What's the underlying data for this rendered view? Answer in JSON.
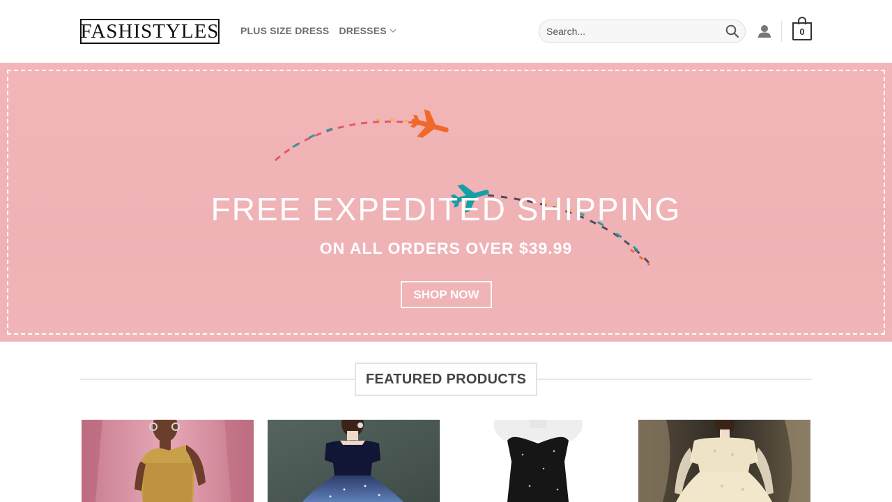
{
  "header": {
    "logo_text": "FASHISTYLES",
    "nav": [
      {
        "label": "PLUS SIZE DRESS",
        "has_dropdown": false
      },
      {
        "label": "DRESSES",
        "has_dropdown": true
      }
    ],
    "search_placeholder": "Search...",
    "cart_count": "0",
    "icons": {
      "search": "search-icon",
      "account": "user-icon",
      "cart": "shopping-bag-icon",
      "dropdown": "chevron-down-icon"
    }
  },
  "banner": {
    "title": "FREE EXPEDITED SHIPPING",
    "subtitle": "ON ALL ORDERS OVER $39.99",
    "button_label": "SHOP NOW",
    "background_color": "#f0b5b8",
    "plane_colors": [
      "#f0692a",
      "#14a0a6"
    ]
  },
  "featured": {
    "heading": "FEATURED PRODUCTS",
    "products": [
      {
        "name": "gold-fringe-dress"
      },
      {
        "name": "navy-velvet-tulle-dress"
      },
      {
        "name": "black-sequin-strapless-dress"
      },
      {
        "name": "champagne-lace-dress"
      }
    ]
  }
}
